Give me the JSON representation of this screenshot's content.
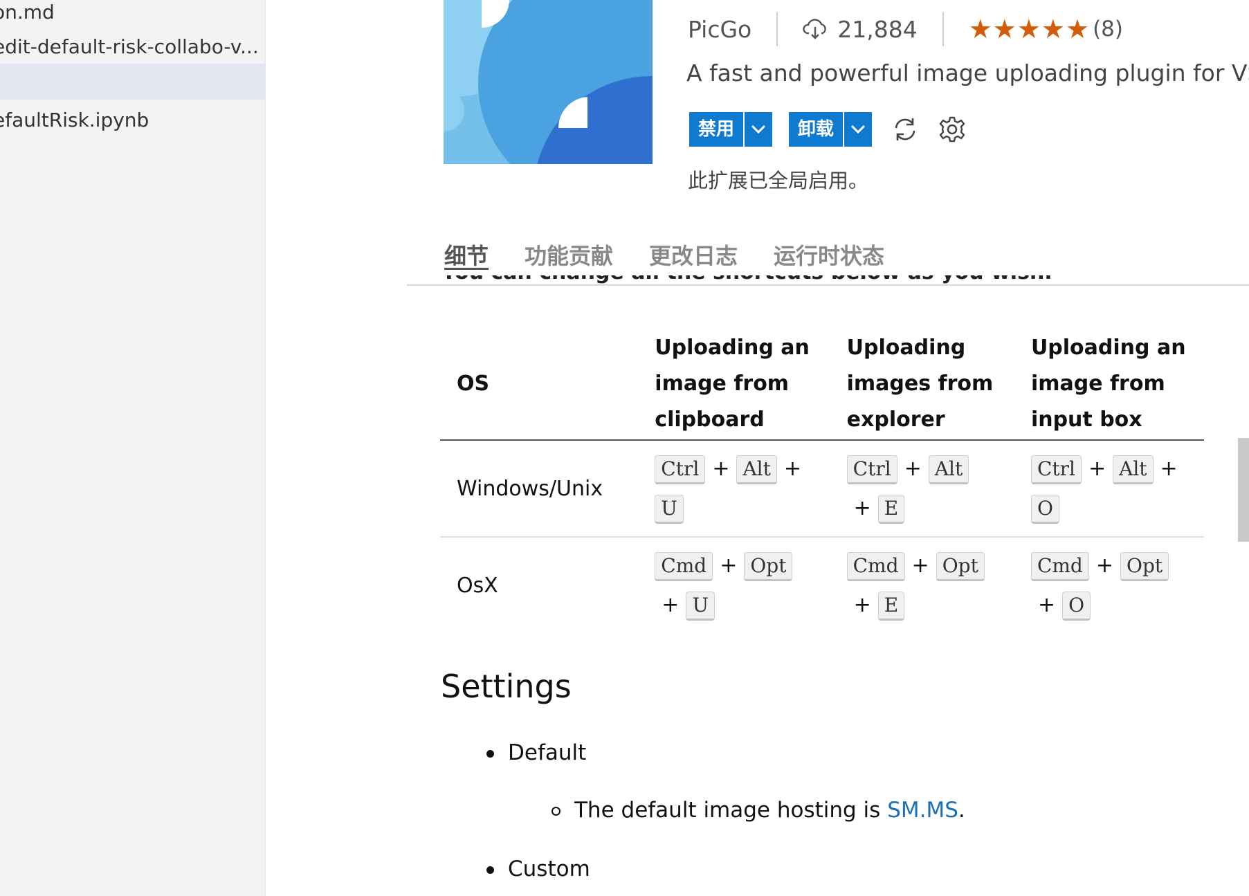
{
  "sidebar": {
    "items": [
      {
        "label": "on.md"
      },
      {
        "label": "edit-default-risk-collabo-v..."
      },
      {
        "label": ""
      },
      {
        "label": "efaultRisk.ipynb"
      }
    ]
  },
  "extension": {
    "publisher": "PicGo",
    "installs": "21,884",
    "stars": "★★★★★",
    "rating_count": "(8)",
    "description": "A fast and powerful image uploading plugin for VSCod",
    "disable_label": "禁用",
    "uninstall_label": "卸载",
    "status": "此扩展已全局启用。"
  },
  "tabs": [
    {
      "label": "细节"
    },
    {
      "label": "功能贡献"
    },
    {
      "label": "更改日志"
    },
    {
      "label": "运行时状态"
    }
  ],
  "content": {
    "cut_line": "You can change all the shortcuts below as you wish.",
    "table": {
      "headers": [
        "OS",
        "Uploading an image from clipboard",
        "Uploading images from explorer",
        "Uploading an image from input box"
      ],
      "rows": [
        {
          "os": "Windows/Unix",
          "keys": [
            [
              "Ctrl",
              "Alt",
              "U"
            ],
            [
              "Ctrl",
              "Alt",
              "E"
            ],
            [
              "Ctrl",
              "Alt",
              "O"
            ]
          ]
        },
        {
          "os": "OsX",
          "keys": [
            [
              "Cmd",
              "Opt",
              "U"
            ],
            [
              "Cmd",
              "Opt",
              "E"
            ],
            [
              "Cmd",
              "Opt",
              "O"
            ]
          ]
        }
      ],
      "plus": "+"
    },
    "settings_heading": "Settings",
    "default_label": "Default",
    "default_text_pre": "The default image hosting is ",
    "default_link": "SM.MS",
    "default_text_post": ".",
    "custom_label": "Custom"
  },
  "colors": {
    "accent": "#0e7ad0",
    "star": "#d45d0b",
    "link": "#1a6fb5"
  },
  "icons": {
    "download": "cloud-download-icon",
    "sync": "sync-icon",
    "settings": "gear-icon",
    "dropdown": "chevron-down-icon",
    "scroll_top": "arrow-up-icon"
  }
}
